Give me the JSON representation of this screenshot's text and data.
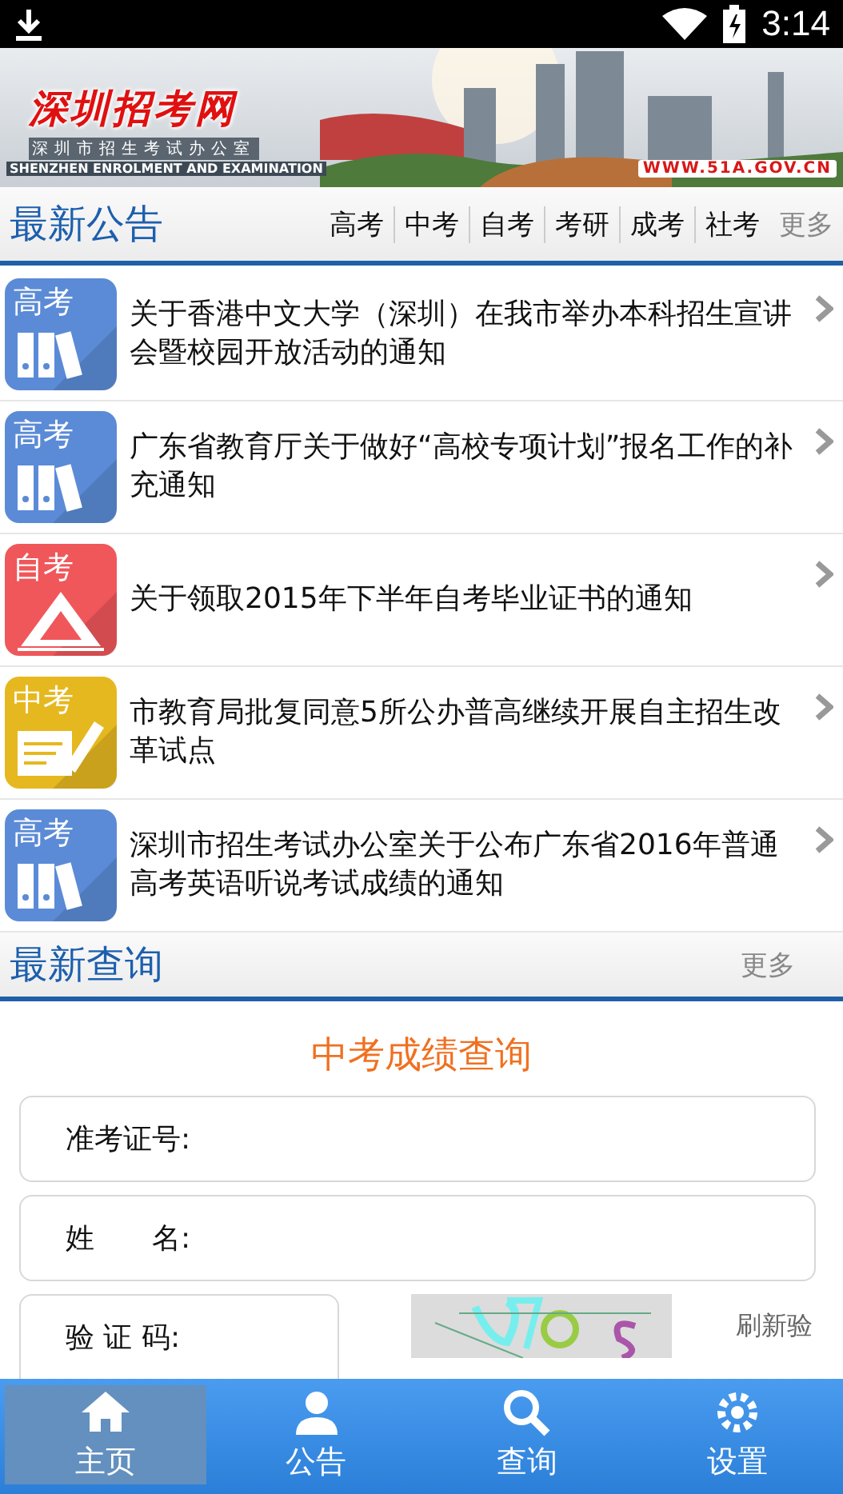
{
  "status_bar": {
    "time": "3:14"
  },
  "banner": {
    "kind": "picture",
    "logo": "深圳招考网",
    "subtitle": "深圳市招生考试办公室",
    "english": "SHENZHEN ENROLMENT AND EXAMINATION",
    "url": "WWW.51A.GOV.CN"
  },
  "notices": {
    "title": "最新公告",
    "tabs": [
      "高考",
      "中考",
      "自考",
      "考研",
      "成考",
      "社考"
    ],
    "more": "更多",
    "items": [
      {
        "category": "高考",
        "kind": "binders",
        "color": "#5b8bd6",
        "text": "关于香港中文大学（深圳）在我市举办本科招生宣讲会暨校园开放活动的通知"
      },
      {
        "category": "高考",
        "kind": "binders",
        "color": "#5b8bd6",
        "text": "广东省教育厅关于做好“高校专项计划”报名工作的补充通知"
      },
      {
        "category": "自考",
        "kind": "triangle",
        "color": "#f0575a",
        "text": "关于领取2015年下半年自考毕业证书的通知"
      },
      {
        "category": "中考",
        "kind": "pencil",
        "color": "#e6b820",
        "text": "市教育局批复同意5所公办普高继续开展自主招生改革试点"
      },
      {
        "category": "高考",
        "kind": "binders",
        "color": "#5b8bd6",
        "text": "深圳市招生考试办公室关于公布广东省2016年普通高考英语听说考试成绩的通知"
      }
    ]
  },
  "queries": {
    "title": "最新查询",
    "more": "更多",
    "form_title": "中考成绩查询",
    "fields": [
      {
        "label": "准考证号:"
      },
      {
        "label": "姓　　名:"
      }
    ],
    "captcha": {
      "label": "验 证 码:",
      "refresh": "刷新验"
    }
  },
  "bottom_nav": [
    {
      "label": "主页",
      "selected": true
    },
    {
      "label": "公告",
      "selected": false
    },
    {
      "label": "查询",
      "selected": false
    },
    {
      "label": "设置",
      "selected": false
    }
  ]
}
